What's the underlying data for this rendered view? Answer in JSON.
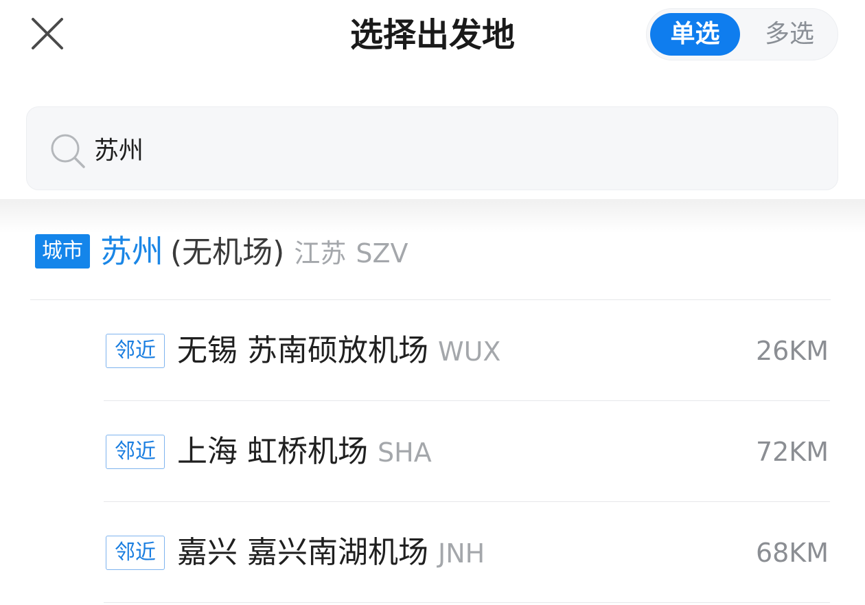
{
  "header": {
    "title": "选择出发地",
    "toggle": {
      "single_label": "单选",
      "multi_label": "多选",
      "selected": "single"
    }
  },
  "search": {
    "value": "苏州",
    "icon": "search-icon"
  },
  "results": {
    "city": {
      "tag": "城市",
      "name": "苏州",
      "note": "(无机场)",
      "province": "江苏",
      "code": "SZV"
    },
    "airports": [
      {
        "tag": "邻近",
        "name": "无锡 苏南硕放机场",
        "code": "WUX",
        "distance": "26KM"
      },
      {
        "tag": "邻近",
        "name": "上海 虹桥机场",
        "code": "SHA",
        "distance": "72KM"
      },
      {
        "tag": "邻近",
        "name": "嘉兴 嘉兴南湖机场",
        "code": "JNH",
        "distance": "68KM"
      }
    ]
  },
  "colors": {
    "accent": "#0f7dee",
    "city_name": "#1a86e6",
    "secondary_text": "#a4a7ab",
    "divider": "#e6e7ea"
  }
}
